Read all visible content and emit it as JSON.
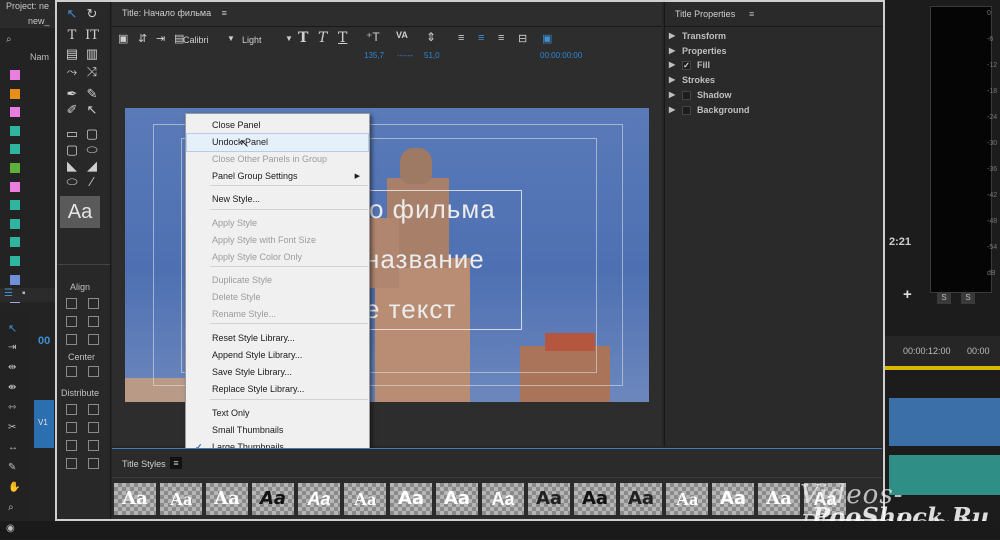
{
  "project": {
    "title": "Project: ne",
    "file": "new_",
    "column_name": "Nam",
    "swatches": [
      "#e87ee0",
      "#e88f1a",
      "#e87ee0",
      "#2fb4a0",
      "#2fb4a0",
      "#5cb03c",
      "#e87ee0",
      "#2fb4a0",
      "#2fb4a0",
      "#2fb4a0",
      "#2fb4a0",
      "#6f8fd8",
      "#b4a0e8"
    ]
  },
  "tools": {
    "align_label": "Align",
    "center_label": "Center",
    "distribute_label": "Distribute",
    "style_preview": "Aa"
  },
  "title_panel": {
    "tab": "Title: Начало фильма",
    "font_family": "Calibri",
    "font_style": "Light",
    "leading_value": "135,7",
    "kerning_value": "51,0",
    "timecode": "00:00:00:00",
    "canvas_text": [
      "о фильма",
      "название",
      "е текст"
    ]
  },
  "menu": {
    "items": [
      {
        "label": "Close Panel",
        "disabled": false
      },
      {
        "label": "Undock Panel",
        "disabled": false,
        "highlighted": true
      },
      {
        "label": "Close Other Panels in Group",
        "disabled": true
      },
      {
        "label": "Panel Group Settings",
        "disabled": false,
        "submenu": true
      },
      {
        "label": "New Style...",
        "disabled": false
      },
      {
        "label": "Apply Style",
        "disabled": true
      },
      {
        "label": "Apply Style with Font Size",
        "disabled": true
      },
      {
        "label": "Apply Style Color Only",
        "disabled": true
      },
      {
        "label": "Duplicate Style",
        "disabled": true
      },
      {
        "label": "Delete Style",
        "disabled": true
      },
      {
        "label": "Rename Style...",
        "disabled": true
      },
      {
        "label": "Reset Style Library...",
        "disabled": false
      },
      {
        "label": "Append Style Library...",
        "disabled": false
      },
      {
        "label": "Save Style Library...",
        "disabled": false
      },
      {
        "label": "Replace Style Library...",
        "disabled": false
      },
      {
        "label": "Text Only",
        "disabled": false
      },
      {
        "label": "Small Thumbnails",
        "disabled": false
      },
      {
        "label": "Large Thumbnails",
        "disabled": false,
        "checked": true
      }
    ],
    "submenu_arrow": "▶",
    "check_mark": "✓"
  },
  "properties": {
    "tab": "Title Properties",
    "rows": [
      "Transform",
      "Properties",
      "Fill",
      "Strokes",
      "Shadow",
      "Background"
    ],
    "fill_check": "✓"
  },
  "title_styles": {
    "tab": "Title Styles",
    "thumb_text": "Aa"
  },
  "timeline": {
    "time_a": "2:21",
    "time_b": "00:00:12:00",
    "time_c": "00:00",
    "track_label": "V1",
    "solo_a": "S",
    "solo_b": "S",
    "add": "+"
  },
  "meter": {
    "db_labels": [
      "0",
      "-6",
      "-12",
      "-18",
      "-24",
      "-30",
      "-36",
      "-42",
      "-48",
      "-54",
      "dB"
    ]
  },
  "watermark": {
    "text": "Videos-Photoshop.ru",
    "text2": "PooShock.Ru"
  },
  "colors": {
    "accent_blue": "#2f87d4",
    "menu_bg": "#f0f0f0",
    "highlight": "#e6f0fb"
  }
}
